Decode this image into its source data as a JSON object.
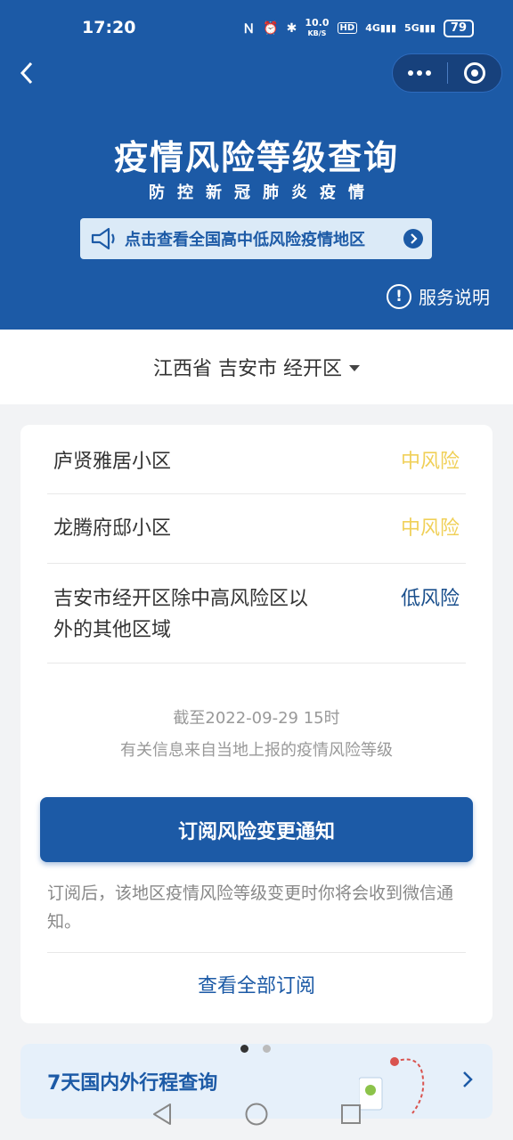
{
  "status_bar": {
    "time": "17:20",
    "network_speed": "10.0",
    "network_unit": "KB/S",
    "hd": "HD",
    "signal_1": "4G",
    "signal_2": "5G",
    "battery": "79"
  },
  "header": {
    "title": "疫情风险等级查询",
    "subtitle": "防控新冠肺炎疫情",
    "banner_text": "点击查看全国高中低风险疫情地区",
    "service_label": "服务说明"
  },
  "region": {
    "label": "江西省 吉安市 经开区"
  },
  "areas": [
    {
      "name": "庐贤雅居小区",
      "level": "中风险"
    },
    {
      "name": "龙腾府邸小区",
      "level": "中风险"
    },
    {
      "name": "吉安市经开区除中高风险区以外的其他区域",
      "level": "低风险"
    }
  ],
  "update": {
    "time_line": "截至2022-09-29 15时",
    "source_line": "有关信息来自当地上报的疫情风险等级"
  },
  "subscribe": {
    "button_label": "订阅风险变更通知",
    "note": "订阅后，该地区疫情风险等级变更时你将会收到微信通知。",
    "view_all_label": "查看全部订阅"
  },
  "promo": {
    "text": "7天国内外行程查询"
  },
  "colors": {
    "primary": "#1c5aa6",
    "mid_risk": "#f0d058",
    "low_risk": "#1a4f8c"
  },
  "icons": [
    "back-icon",
    "more-icon",
    "close-miniprogram-icon",
    "megaphone-icon",
    "arrow-right-icon",
    "info-icon",
    "dropdown-icon",
    "chevron-right-icon",
    "nav-back-icon",
    "nav-home-icon",
    "nav-recent-icon"
  ]
}
